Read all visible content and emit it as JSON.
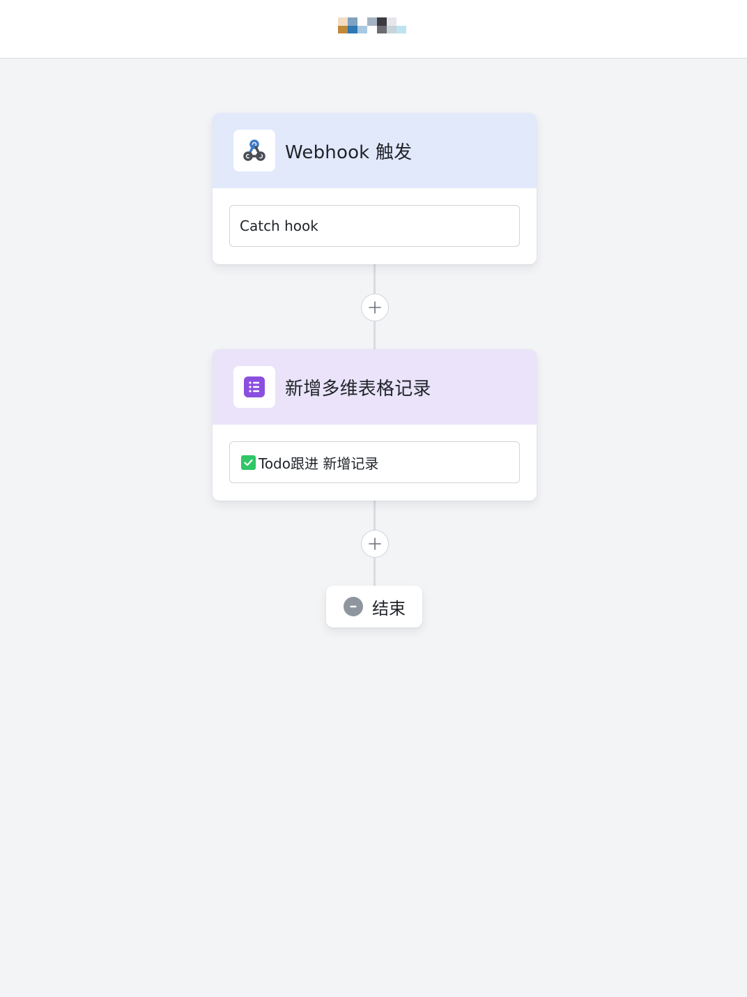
{
  "header": {
    "logo_pixels": [
      "#f2ddc4",
      "#7ea2c0",
      "#ffffff",
      "#a5b2c2",
      "#3b3a3f",
      "#e6e7ea",
      "#ffffff",
      "#c08a3a",
      "#2e78b5",
      "#a9c9e2",
      "#ffffff",
      "#6d6b72",
      "#c9d3da",
      "#bde4f0"
    ]
  },
  "flow": {
    "nodes": [
      {
        "title": "Webhook 触发",
        "icon": "webhook-icon",
        "header_color": "#e1e9fb",
        "step_label": "Catch hook"
      },
      {
        "title": "新增多维表格记录",
        "icon": "bitable-icon",
        "header_color": "#eae3f9",
        "step_label": "Todo跟进 新增记录",
        "step_icon": "check-icon"
      }
    ],
    "add_step_icon": "plus-icon",
    "end": {
      "label": "结束",
      "icon": "minus-circle-icon"
    }
  },
  "colors": {
    "background": "#f3f4f6",
    "accent_purple": "#8b4fe0",
    "check_green": "#2fc667"
  }
}
